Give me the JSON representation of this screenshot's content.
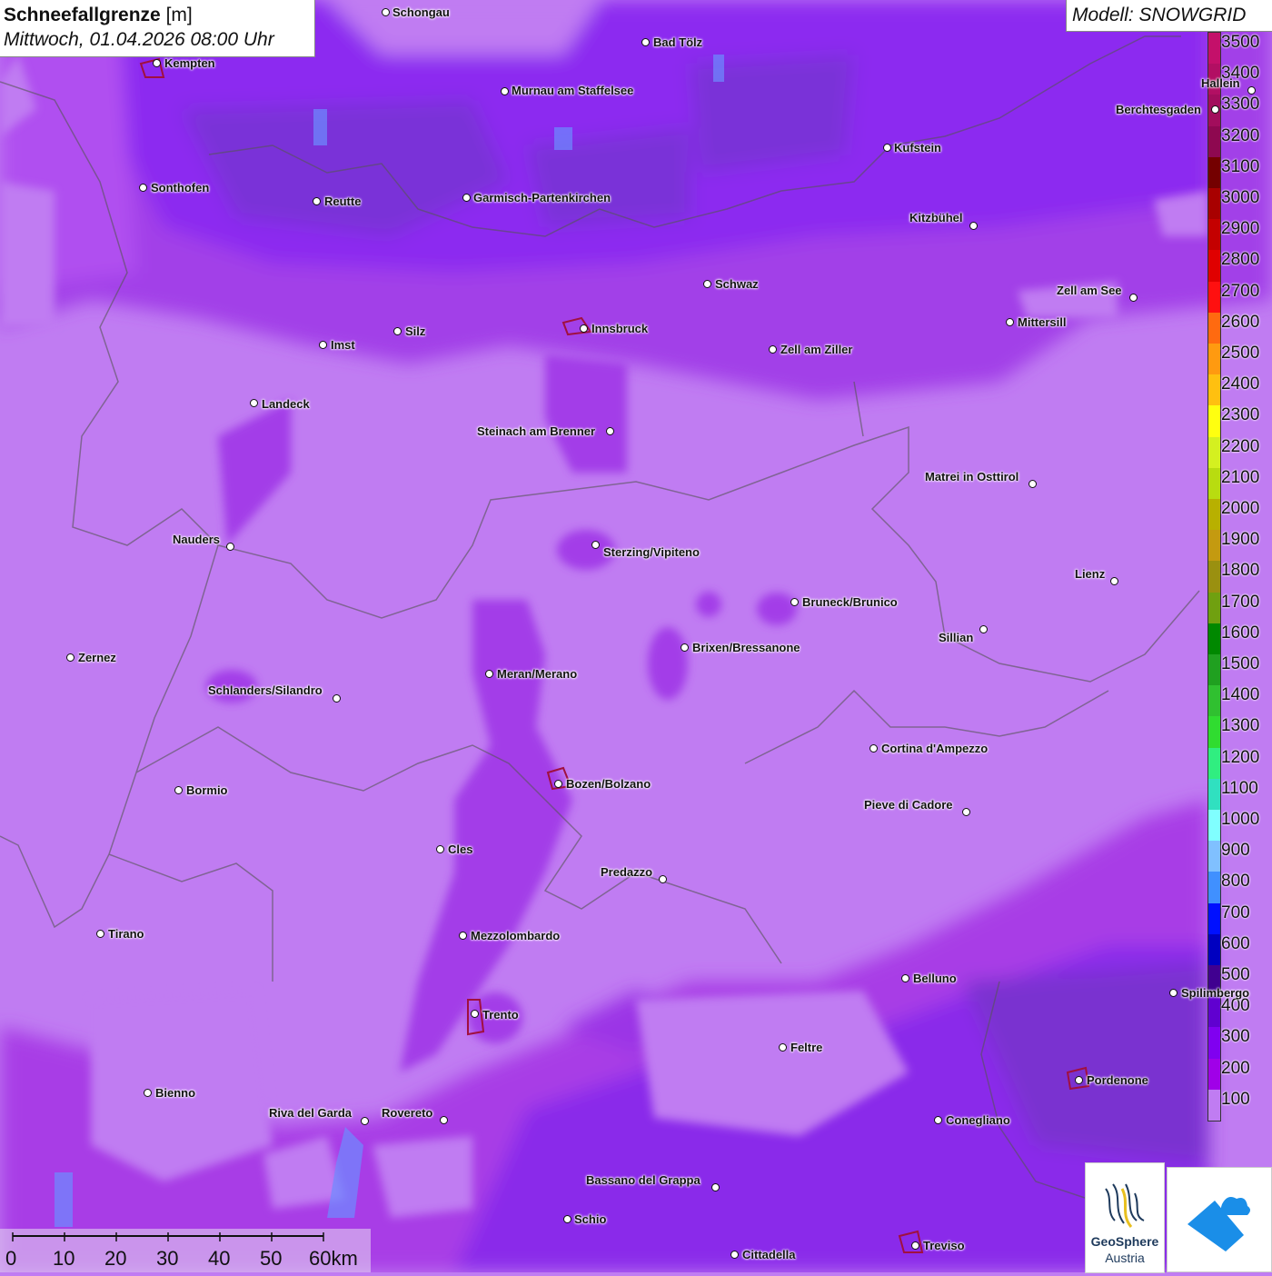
{
  "header": {
    "title": "Schneefallgrenze",
    "unit": " [m]",
    "datetime": "Mittwoch, 01.04.2026 08:00 Uhr"
  },
  "model": {
    "label": "Modell: SNOWGRID"
  },
  "legend": {
    "unit": "m",
    "levels": [
      "3500",
      "3400",
      "3300",
      "3200",
      "3100",
      "3000",
      "2900",
      "2800",
      "2700",
      "2600",
      "2500",
      "2400",
      "2300",
      "2200",
      "2100",
      "2000",
      "1900",
      "1800",
      "1700",
      "1600",
      "1500",
      "1400",
      "1300",
      "1200",
      "1100",
      "1000",
      "900",
      "800",
      "700",
      "600",
      "500",
      "400",
      "300",
      "200",
      "100"
    ],
    "colors": [
      "#c4106a",
      "#b20f63",
      "#a20d5c",
      "#8e0850",
      "#740000",
      "#a80000",
      "#c40000",
      "#e00000",
      "#ff1010",
      "#ff6a10",
      "#ff9a10",
      "#ffc010",
      "#ffff10",
      "#d4f020",
      "#b8dc10",
      "#b8b000",
      "#c49a10",
      "#9a9010",
      "#70a010",
      "#008800",
      "#20a020",
      "#30c030",
      "#30dc30",
      "#30ee80",
      "#30e0c0",
      "#80ffff",
      "#80c0ff",
      "#4090ff",
      "#0010ff",
      "#0000c0",
      "#400090",
      "#6000d0",
      "#8000f0",
      "#a000e8",
      "#c07cf2"
    ]
  },
  "cities": [
    {
      "name": "Schongau"
    },
    {
      "name": "Bad Tölz"
    },
    {
      "name": "Kempten"
    },
    {
      "name": "Murnau am Staffelsee"
    },
    {
      "name": "Hallein"
    },
    {
      "name": "Berchtesgaden"
    },
    {
      "name": "Kufstein"
    },
    {
      "name": "Sonthofen"
    },
    {
      "name": "Reutte"
    },
    {
      "name": "Garmisch-Partenkirchen"
    },
    {
      "name": "Kitzbühel"
    },
    {
      "name": "Schwaz"
    },
    {
      "name": "Zell am See"
    },
    {
      "name": "Mittersill"
    },
    {
      "name": "Innsbruck"
    },
    {
      "name": "Silz"
    },
    {
      "name": "Imst"
    },
    {
      "name": "Zell am Ziller"
    },
    {
      "name": "Landeck"
    },
    {
      "name": "Steinach am Brenner"
    },
    {
      "name": "Matrei in Osttirol"
    },
    {
      "name": "Nauders"
    },
    {
      "name": "Sterzing/Vipiteno"
    },
    {
      "name": "Lienz"
    },
    {
      "name": "Bruneck/Brunico"
    },
    {
      "name": "Sillian"
    },
    {
      "name": "Brixen/Bressanone"
    },
    {
      "name": "Zernez"
    },
    {
      "name": "Meran/Merano"
    },
    {
      "name": "Schlanders/Silandro"
    },
    {
      "name": "Cortina d'Ampezzo"
    },
    {
      "name": "Bozen/Bolzano"
    },
    {
      "name": "Bormio"
    },
    {
      "name": "Pieve di Cadore"
    },
    {
      "name": "Cles"
    },
    {
      "name": "Predazzo"
    },
    {
      "name": "Tirano"
    },
    {
      "name": "Mezzolombardo"
    },
    {
      "name": "Belluno"
    },
    {
      "name": "Spilimbergo"
    },
    {
      "name": "Trento"
    },
    {
      "name": "Feltre"
    },
    {
      "name": "Pordenone"
    },
    {
      "name": "Bienno"
    },
    {
      "name": "Riva del Garda"
    },
    {
      "name": "Rovereto"
    },
    {
      "name": "Conegliano"
    },
    {
      "name": "Bassano del Grappa"
    },
    {
      "name": "Schio"
    },
    {
      "name": "Treviso"
    },
    {
      "name": "Cittadella"
    }
  ],
  "scalebar": {
    "ticks": [
      "0",
      "10",
      "20",
      "30",
      "40",
      "50",
      "60km"
    ]
  },
  "logos": {
    "geosphere": "GeoSphere",
    "austria": "Austria"
  }
}
